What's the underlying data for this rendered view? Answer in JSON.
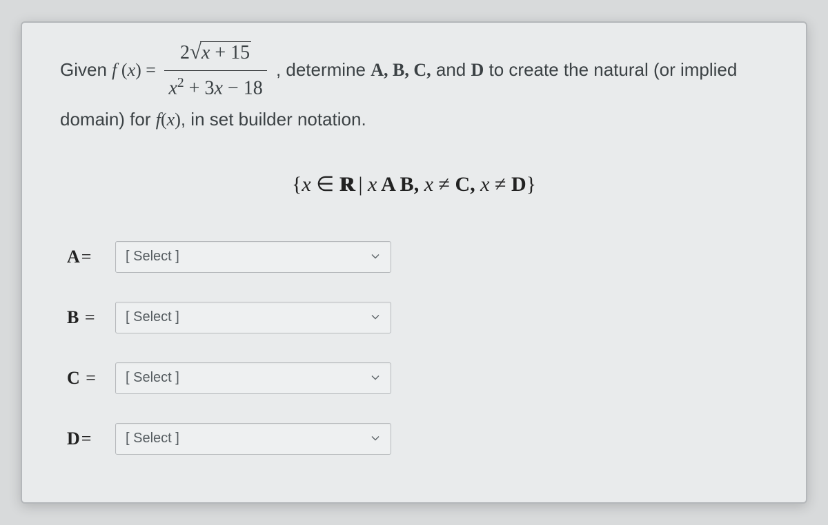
{
  "question": {
    "prefix": "Given ",
    "func_lhs": "f (x) = ",
    "fraction_num_coeff": "2",
    "fraction_num_radicand": "x + 15",
    "fraction_den": "x² + 3x − 18",
    "mid1": ", determine ",
    "vars": "A, B, C,",
    "and": " and ",
    "varD": "D",
    "mid2": " to create the natural (or implied domain) for ",
    "func_ref": "f(x)",
    "tail": ", in set builder notation."
  },
  "set_builder": {
    "open": "{",
    "x": "x",
    "elem": " ∈ ",
    "reals": "R",
    "bar": " | ",
    "part1a": "x",
    "part1b": " A B, ",
    "part2a": "x",
    "neq1": " ≠ ",
    "part2b": "C, ",
    "part3a": "x",
    "neq2": " ≠ ",
    "part3b": "D",
    "close": "}"
  },
  "answers": [
    {
      "label": "A",
      "placeholder": "[ Select ]"
    },
    {
      "label": "B",
      "placeholder": "[ Select ]"
    },
    {
      "label": "C",
      "placeholder": "[ Select ]"
    },
    {
      "label": "D",
      "placeholder": "[ Select ]"
    }
  ]
}
